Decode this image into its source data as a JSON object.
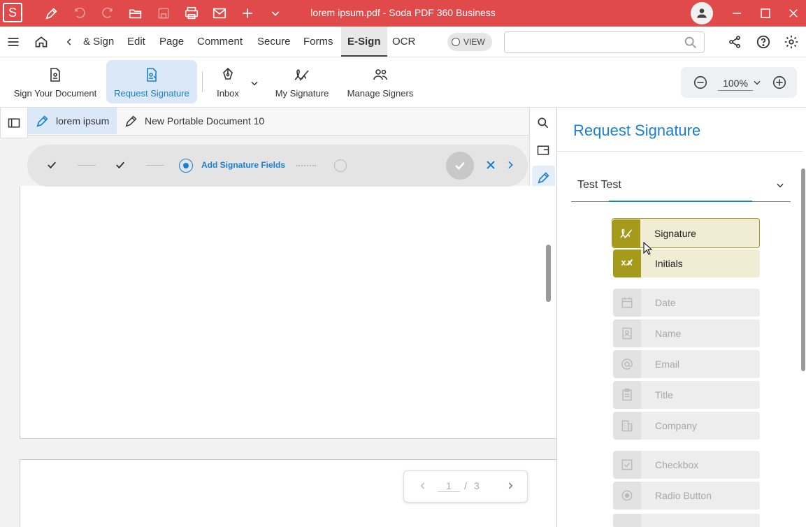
{
  "app": {
    "title": "lorem ipsum.pdf   -   Soda PDF 360 Business",
    "logo_letter": "S"
  },
  "menu": {
    "back_item": "& Sign",
    "items": [
      "Edit",
      "Page",
      "Comment",
      "Secure",
      "Forms",
      "E-Sign",
      "OCR"
    ],
    "active": "E-Sign",
    "view_label": "VIEW",
    "search_placeholder": ""
  },
  "ribbon": {
    "buttons": [
      {
        "label": "Sign Your Document",
        "icon": "sign-document-icon"
      },
      {
        "label": "Request Signature",
        "icon": "request-signature-icon",
        "active": true
      },
      {
        "label": "Inbox",
        "icon": "pen-nib-icon"
      },
      {
        "label": "My Signature",
        "icon": "signature-icon"
      },
      {
        "label": "Manage Signers",
        "icon": "users-icon"
      }
    ],
    "zoom": "100%"
  },
  "tabs": [
    {
      "label": "lorem ipsum",
      "active": true
    },
    {
      "label": "New Portable Document 10",
      "active": false
    }
  ],
  "stepper": {
    "current_step_label": "Add Signature Fields"
  },
  "pager": {
    "current": "1",
    "separator": "/",
    "total": "3"
  },
  "panel": {
    "title": "Request Signature",
    "signer": "Test Test",
    "active_fields": [
      {
        "label": "Signature",
        "icon": "signature-icon",
        "selected": true
      },
      {
        "label": "Initials",
        "icon": "initials-icon",
        "selected": false
      }
    ],
    "disabled_fields": [
      {
        "label": "Date",
        "icon": "calendar-icon"
      },
      {
        "label": "Name",
        "icon": "id-card-icon"
      },
      {
        "label": "Email",
        "icon": "at-icon"
      },
      {
        "label": "Title",
        "icon": "clipboard-icon"
      },
      {
        "label": "Company",
        "icon": "building-icon"
      },
      {
        "label": "Checkbox",
        "icon": "checkbox-icon"
      },
      {
        "label": "Radio Button",
        "icon": "radio-icon"
      }
    ]
  },
  "colors": {
    "titlebar": "#e04a4a",
    "accent": "#1a7fd1",
    "gold": "#a69a1c"
  }
}
